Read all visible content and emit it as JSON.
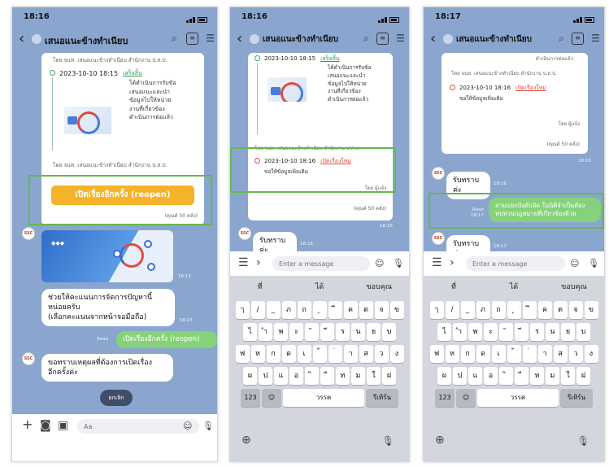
{
  "screens": [
    {
      "status_time": "18:16",
      "title": "เสนอแนะข้างทำเนียบ",
      "card": {
        "event_time": "2023-10-10 18:15",
        "event_link": "เสร็จสิ้น",
        "desc_lines": [
          "ได้ดำเนินการรับข้อ",
          "เสนอแนะและนำ",
          "ข้อมูลไปให้หน่วย",
          "งานที่เกี่ยวข้อง",
          "ดำเนินการต่อแล้ว"
        ],
        "footer": "โดย จนท. เสนอแนะข้างทำเนียบ สำนักงาน ป.ส.ป.",
        "top_line": "โดย จนท. เสนอแนะข้างทำเนียบ สำนักงาน ป.ส.ป.",
        "reopen_label": "เปิดเรื่องอีกครั้ง (reopen)",
        "rating": "(คุณค์ 50 คลั่ง)"
      },
      "bubbles": {
        "ask": [
          "ช่วยให้คะแนนการจัดการปัญหานี้",
          "หน่อยครับ",
          "(เลือกคะแนนจากหน้าจอมือถือ)"
        ],
        "reply": "เปิดเรื่องอีกครั้ง (reopen)",
        "request": [
          "ขอทราบเหตุผลที่ต้องการเปิดเรื่อง",
          "อีกครั้งค่ะ"
        ],
        "cancel": "ยกเลิก",
        "reply_meta": "Read",
        "time_a": "18:15",
        "time_b": "18:15"
      },
      "input_placeholder": "Aa"
    },
    {
      "status_time": "18:16",
      "title": "เสนอแนะข้างทำเนียบ",
      "card": {
        "top_time": "2023-10-10 18:15",
        "top_link": "เสร็จสิ้น",
        "desc_lines": [
          "ได้ดำเนินการรับข้อ",
          "เสนอแนะและนำ",
          "ข้อมูลไปให้หน่วย",
          "งานที่เกี่ยวข้อง",
          "ดำเนินการต่อแล้ว"
        ],
        "footer": "โดย จนท. เสนอแนะข้างทำเนียบ สำนักงาน ป.ส.ป.",
        "event_time": "2023-10-10 18:16",
        "event_link": "เปิดเรื่องใหม่",
        "event_desc": "ขอให้ข้อมูลเพิ่มเติม",
        "signer": "โดย ผู้แจ้ง",
        "rating": "(คุณค์ 50 คลั่ง)",
        "time": "18:16"
      },
      "bubbles": {
        "ack": "รับทราบค่ะ",
        "time": "18:16"
      },
      "input_placeholder": "Enter a message",
      "suggestions": [
        "ที่",
        "ได้",
        "ขอบคุณ"
      ]
    },
    {
      "status_time": "18:17",
      "title": "เสนอแนะข้างทำเนียบ",
      "card": {
        "top_line": "ดำเนินการต่อแล้ว",
        "footer": "โดย จนท. เสนอแนะข้างทำเนียบ สำนักงาน ป.ส.ป.",
        "event_time": "2023-10-10 18:16",
        "event_link": "เปิดเรื่องใหม่",
        "event_desc": "ขอให้ข้อมูลเพิ่มเติม",
        "signer": "โดย ผู้แจ้ง",
        "rating": "(คุณค์ 50 คลั่ง)",
        "time": "18:16"
      },
      "bubbles": {
        "ack1": "รับทราบค่ะ",
        "ack1_time": "18:16",
        "green": [
          "สามแยกบังคับอัด ในนิติจำเป็นต้อง",
          "ทบทวนกฎหมายที่เกี่ยวข้องด้วย"
        ],
        "green_meta": [
          "Read",
          "18:17"
        ],
        "ack2": "รับทราบค่ะ",
        "ack2_time": "18:17"
      },
      "input_placeholder": "Enter a message",
      "suggestions": [
        "ที่",
        "ได้",
        "ขอบคุณ"
      ]
    }
  ],
  "keyboard": {
    "row1": [
      "ๅ",
      "/",
      "_",
      "ภ",
      "ถ",
      "ุ",
      "ึ",
      "ค",
      "ต",
      "จ",
      "ข"
    ],
    "row2": [
      "ไ",
      "ำ",
      "พ",
      "ะ",
      "ั",
      "ี",
      "ร",
      "น",
      "ย",
      "บ"
    ],
    "row3": [
      "ฟ",
      "ห",
      "ก",
      "ด",
      "เ",
      "้",
      "่",
      "า",
      "ส",
      "ว",
      "ง"
    ],
    "row4": [
      "ผ",
      "ป",
      "แ",
      "อ",
      "ิ",
      "ื",
      "ท",
      "ม",
      "ใ",
      "ฝ"
    ],
    "num_key": "123",
    "space": "วรรค",
    "return": "รีเทิร์น"
  },
  "colors": {
    "chat_bg": "#8aa6cf",
    "highlight_frame": "#66b84b",
    "reopen_button": "#f5b32a",
    "green_bubble": "#86d27a"
  }
}
